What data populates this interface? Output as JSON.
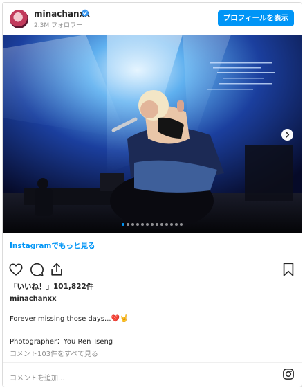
{
  "header": {
    "username": "minachanxx",
    "followers": "2.3M フォロワー",
    "profile_button": "プロフィールを表示"
  },
  "carousel": {
    "slide_count": 13,
    "active_index": 0
  },
  "links": {
    "view_more": "Instagramでもっと見る"
  },
  "post": {
    "likes": "「いいね！」101,822件",
    "caption_username": "minachanxx",
    "caption_text": "Forever missing those days...",
    "caption_emoji": "💔🤘",
    "photographer": "Photographer：You Ren Tseng",
    "view_comments": "コメント103件をすべて見る"
  },
  "comment": {
    "placeholder": "コメントを追加..."
  },
  "colors": {
    "accent": "#0095f6",
    "muted": "#8e8e8e",
    "text": "#262626"
  },
  "icons": [
    "verified-badge-icon",
    "heart-icon",
    "comment-icon",
    "share-icon",
    "bookmark-icon",
    "chevron-right-icon",
    "instagram-icon"
  ]
}
